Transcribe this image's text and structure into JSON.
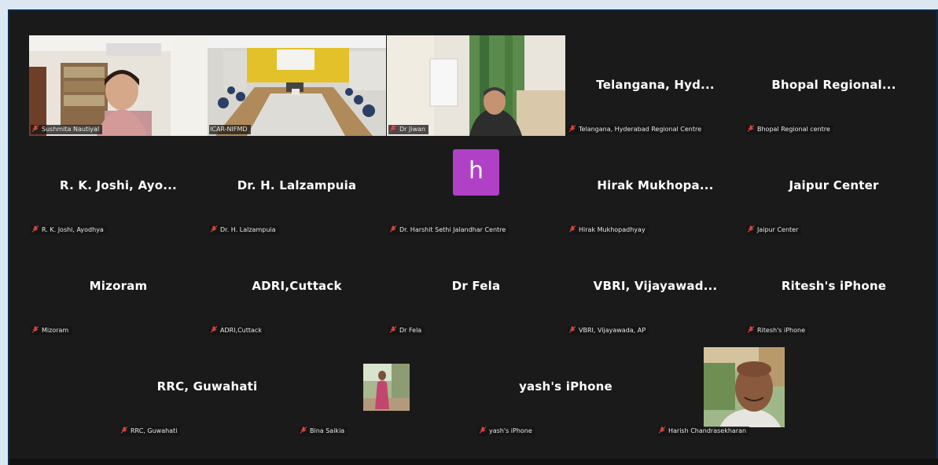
{
  "participants": [
    {
      "display": "",
      "label": "Sushmita Nautiyal",
      "video": "woman"
    },
    {
      "display": "",
      "label": "ICAR-NIFMD",
      "video": "room",
      "active": true
    },
    {
      "display": "",
      "label": "Dr Jiwan",
      "video": "man"
    },
    {
      "display": "Telangana, Hyd...",
      "label": "Telangana, Hyderabad Regional Centre"
    },
    {
      "display": "Bhopal Regional...",
      "label": "Bhopal Regional centre"
    },
    {
      "display": "R. K. Joshi, Ayo...",
      "label": "R. K. Joshi, Ayodhya"
    },
    {
      "display": "Dr. H. Lalzampuia",
      "label": "Dr. H. Lalzampuia"
    },
    {
      "display": "h",
      "label": "Dr. Harshit Sethi Jalandhar Centre",
      "avatar": true
    },
    {
      "display": "Hirak Mukhopa...",
      "label": "Hirak Mukhopadhyay"
    },
    {
      "display": "Jaipur Center",
      "label": "Jaipur Center"
    },
    {
      "display": "Mizoram",
      "label": "Mizoram"
    },
    {
      "display": "ADRI,Cuttack",
      "label": "ADRI,Cuttack"
    },
    {
      "display": "Dr Fela",
      "label": "Dr Fela"
    },
    {
      "display": "VBRI, Vijayawad...",
      "label": "VBRI, Vijayawada, AP"
    },
    {
      "display": "Ritesh's iPhone",
      "label": "Ritesh's iPhone"
    },
    {
      "display": "RRC, Guwahati",
      "label": "RRC, Guwahati"
    },
    {
      "display": "",
      "label": "Bina Saikia",
      "video": "bina"
    },
    {
      "display": "yash's iPhone",
      "label": "yash's iPhone"
    },
    {
      "display": "",
      "label": "Harish Chandrasekharan",
      "video": "harish"
    }
  ],
  "colors": {
    "active_border": "#3cc46a",
    "avatar_bg": "#b040c6",
    "muted_mic": "#e0463c",
    "tile_bg": "#1a1a1a"
  },
  "icons": {
    "muted": "mic-off-icon"
  }
}
